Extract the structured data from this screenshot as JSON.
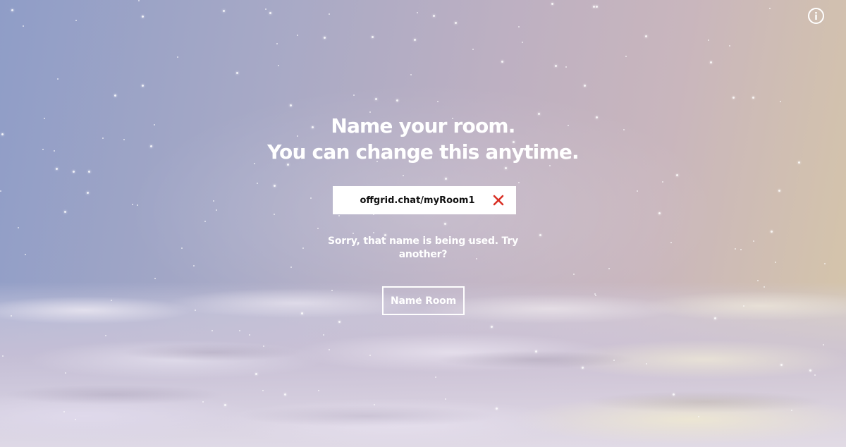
{
  "header": {
    "info_icon": "info-circle-icon"
  },
  "main": {
    "heading_line1": "Name your room.",
    "heading_line2": "You can change this anytime.",
    "room_input": {
      "value": "offgrid.chat/myRoom1"
    },
    "clear_icon": "close-x-icon",
    "error_message": "Sorry, that name is being used. Try another?",
    "submit_label": "Name Room"
  },
  "colors": {
    "error_x": "#d93025",
    "text": "#ffffff",
    "input_background": "#ffffff"
  }
}
